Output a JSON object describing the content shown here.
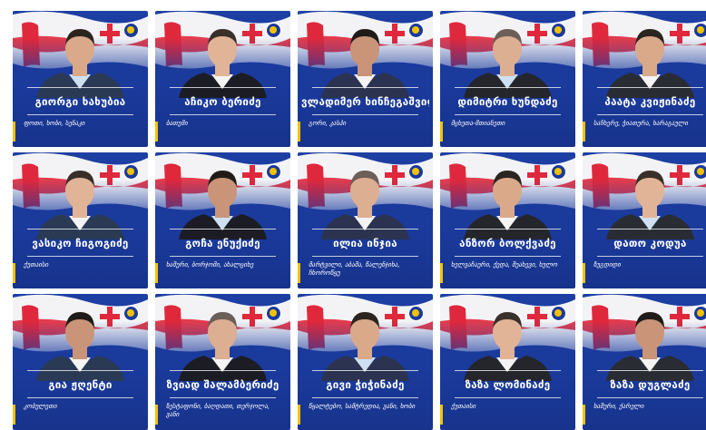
{
  "colors": {
    "card_bg": "#1a3a9c",
    "flag_red": "#e0283c",
    "accent_yellow": "#f2c200"
  },
  "candidates": [
    {
      "name": "გიორგი ხახუბია",
      "region": "ფოთი, ხობი, სენაკი"
    },
    {
      "name": "აჩიკო ბერიძე",
      "region": "ბათუმი"
    },
    {
      "name": "ვლადიმერ ხინჩეგაშვილი",
      "region": "გორი, კასპი"
    },
    {
      "name": "დიმიტრი ხუნდაძე",
      "region": "მცხეთა-მთიანეთი"
    },
    {
      "name": "პაატა კვიჟინაძე",
      "region": "საჩხერე, ჭიათურა, ხარაგაული"
    },
    {
      "name": "ვასიკო ჩიგოგიძე",
      "region": "ქუთაისი"
    },
    {
      "name": "გოჩა ენუქიძე",
      "region": "ხაშური, ბორჯომი, ახალციხე"
    },
    {
      "name": "ილია ინჯია",
      "region": "მარტვილი, აბაშა, წალენჯიხა, ჩხოროწყუ"
    },
    {
      "name": "ანზორ ბოლქვაძე",
      "region": "ხელვაჩაური, ქედა, შუახევი, ხულო"
    },
    {
      "name": "დათო კოდუა",
      "region": "ზუგდიდი"
    },
    {
      "name": "გია ჟღენტი",
      "region": "კობულეთი"
    },
    {
      "name": "ზვიად შალამბერიძე",
      "region": "ზესტაფონი, ბაღდათი, თერჯოლა, ვანი"
    },
    {
      "name": "გივი ჭიჭინაძე",
      "region": "წყალტუბო, სამტრედია, ვანი, ხობი"
    },
    {
      "name": "ზაზა ლომინაძე",
      "region": "ქუთაისი"
    },
    {
      "name": "ზაზა დუგლაძე",
      "region": "ხაშური, ქარელი"
    }
  ]
}
